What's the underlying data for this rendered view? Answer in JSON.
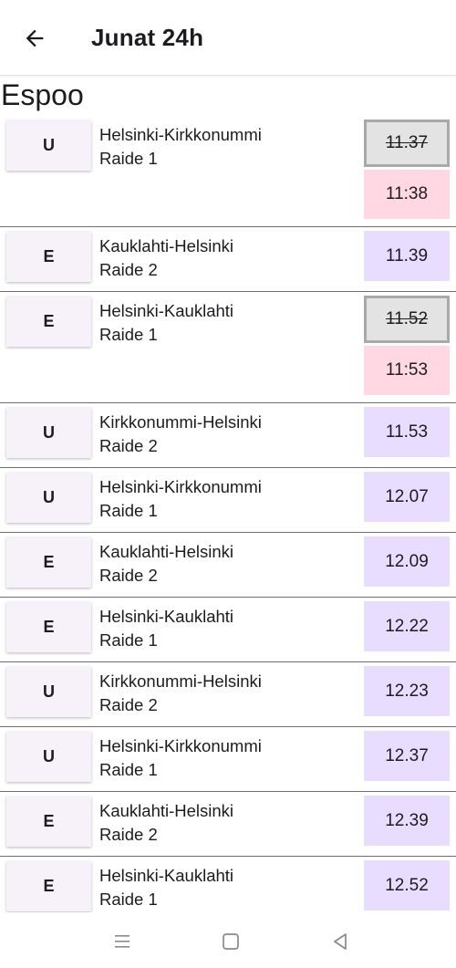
{
  "header": {
    "title": "Junat 24h",
    "back_icon": "arrow-back-icon"
  },
  "station": "Espoo",
  "colors": {
    "badge_bg": "#f7f2fa",
    "time_bg": "#e8ddff",
    "cancelled_time_bg": "#e3e3e3",
    "new_time_bg": "#ffd8e4"
  },
  "trains": [
    {
      "line": "U",
      "route": "Helsinki-Kirkkonummi",
      "track": "Raide 1",
      "time": "11.37",
      "new_time": "11:38",
      "delayed": true
    },
    {
      "line": "E",
      "route": "Kauklahti-Helsinki",
      "track": "Raide 2",
      "time": "11.39",
      "delayed": false
    },
    {
      "line": "E",
      "route": "Helsinki-Kauklahti",
      "track": "Raide 1",
      "time": "11.52",
      "new_time": "11:53",
      "delayed": true
    },
    {
      "line": "U",
      "route": "Kirkkonummi-Helsinki",
      "track": "Raide 2",
      "time": "11.53",
      "delayed": false
    },
    {
      "line": "U",
      "route": "Helsinki-Kirkkonummi",
      "track": "Raide 1",
      "time": "12.07",
      "delayed": false
    },
    {
      "line": "E",
      "route": "Kauklahti-Helsinki",
      "track": "Raide 2",
      "time": "12.09",
      "delayed": false
    },
    {
      "line": "E",
      "route": "Helsinki-Kauklahti",
      "track": "Raide 1",
      "time": "12.22",
      "delayed": false
    },
    {
      "line": "U",
      "route": "Kirkkonummi-Helsinki",
      "track": "Raide 2",
      "time": "12.23",
      "delayed": false
    },
    {
      "line": "U",
      "route": "Helsinki-Kirkkonummi",
      "track": "Raide 1",
      "time": "12.37",
      "delayed": false
    },
    {
      "line": "E",
      "route": "Kauklahti-Helsinki",
      "track": "Raide 2",
      "time": "12.39",
      "delayed": false
    },
    {
      "line": "E",
      "route": "Helsinki-Kauklahti",
      "track": "Raide 1",
      "time": "12.52",
      "delayed": false
    }
  ],
  "navbar": {
    "menu_icon": "recent-apps-icon",
    "home_icon": "home-icon",
    "back_icon": "system-back-icon"
  }
}
